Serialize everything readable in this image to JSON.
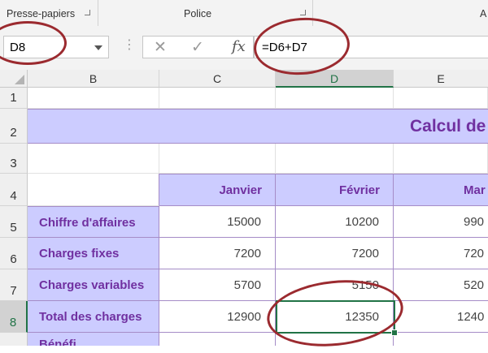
{
  "ribbon": {
    "groups": [
      "Presse-papiers",
      "Police",
      "A"
    ]
  },
  "formula_bar": {
    "name_box": "D8",
    "cancel_icon": "x-icon",
    "enter_icon": "check-icon",
    "fx_label": "fx",
    "formula": "=D6+D7"
  },
  "columns": [
    "B",
    "C",
    "D",
    "E"
  ],
  "rows": [
    "1",
    "2",
    "3",
    "4",
    "5",
    "6",
    "7",
    "8"
  ],
  "sheet": {
    "title": "Calcul de",
    "headers": [
      "Janvier",
      "Février",
      "Mar"
    ],
    "row_labels": [
      "Chiffre d'affaires",
      "Charges fixes",
      "Charges variables",
      "Total des charges",
      "Bénéfi"
    ],
    "values": [
      [
        "15000",
        "10200",
        "990"
      ],
      [
        "7200",
        "7200",
        "720"
      ],
      [
        "5700",
        "5150",
        "520"
      ],
      [
        "12900",
        "12350",
        "1240"
      ]
    ]
  },
  "selected_cell": "D8",
  "colors": {
    "accent_purple": "#7030a0",
    "band_fill": "#ccccff",
    "selection_green": "#217346",
    "annotation_red": "#9b2a2f"
  }
}
